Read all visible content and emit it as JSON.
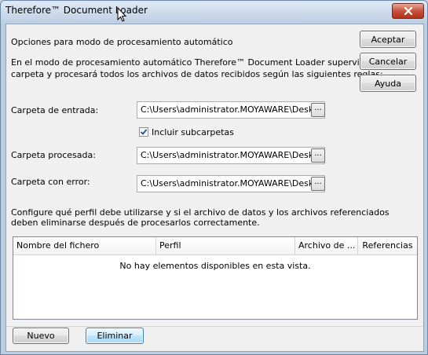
{
  "window": {
    "title": "Therefore™ Document Loader"
  },
  "intro": {
    "heading": "Opciones para modo de procesamiento automático",
    "line1": "En el modo de procesamiento automático Therefore™ Document Loader supervisará una",
    "line2": "carpeta y procesará todos los archivos de datos recibidos según las siguientes reglas:"
  },
  "buttons": {
    "ok": "Aceptar",
    "cancel": "Cancelar",
    "help": "Ayuda",
    "new": "Nuevo",
    "delete": "Eliminar",
    "browse": "..."
  },
  "input_folder": {
    "label": "Carpeta de entrada:",
    "value": "C:\\Users\\administrator.MOYAWARE\\Desktop"
  },
  "subfolders": {
    "label": "Incluir subcarpetas",
    "checked": true
  },
  "processed_folder": {
    "label": "Carpeta procesada:",
    "value": "C:\\Users\\administrator.MOYAWARE\\Desktop"
  },
  "error_folder": {
    "label": "Carpeta con error:",
    "value": "C:\\Users\\administrator.MOYAWARE\\Desktop"
  },
  "profile_note": {
    "line1": "Configure qué perfil debe utilizarse y si el archivo de datos y los archivos referenciados",
    "line2": "deben eliminarse después de procesarlos correctamente."
  },
  "list": {
    "columns": [
      "Nombre del fichero",
      "Perfil",
      "Archivo de ...",
      "Referencias"
    ],
    "empty_text": "No hay elementos disponibles en esta vista."
  },
  "icons": {
    "close": "close-icon",
    "check": "checkmark-icon",
    "cursor": "mouse-cursor-icon"
  }
}
